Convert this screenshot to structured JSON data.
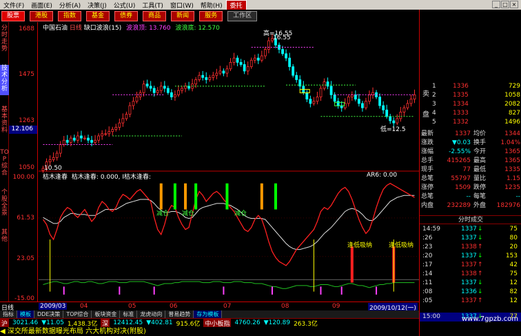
{
  "menu": {
    "items": [
      "文件(F)",
      "画面(E)",
      "分析(A)",
      "决策(J)",
      "公式(U)",
      "工具(T)",
      "窗口(W)",
      "帮助(H)"
    ],
    "highlight": "委托"
  },
  "toolbar": {
    "buttons": [
      "股票",
      "港股",
      "指数",
      "基金",
      "债券",
      "商品",
      "新闻",
      "服务"
    ],
    "extra": "工作区"
  },
  "left_tabs": [
    "分时走势",
    "技术分析",
    "基本资料",
    "TOP综合",
    "个股全景",
    "其他"
  ],
  "yaxis": {
    "upper": [
      "1688",
      "1475",
      "1263",
      "1050"
    ],
    "current": "12.106",
    "lower": [
      "100.00",
      "61.53",
      "23.05",
      "-15.00"
    ]
  },
  "price_panel": {
    "title": "中国石油",
    "period": "日线",
    "indicator": "缺口波浪(15)",
    "wave_top_label": "波浪顶:",
    "wave_top_value": "13.760",
    "wave_bottom_label": "波浪底:",
    "wave_bottom_value": "12.570",
    "high_label": "高=16.55",
    "high_value": "16.55",
    "low_label": "低=12.5",
    "left_value": "10.50"
  },
  "osc_panel": {
    "title": "枯木逢春",
    "value_label": "枯木逢春:",
    "value": "0.000,",
    "extra": "I枯木逢春:",
    "side_label": "AR6:",
    "side_value": "0.00",
    "reduce_label": "减仓",
    "buy_label": "逢低吸纳"
  },
  "chart_data": {
    "type": "candlestick",
    "x_labels": [
      "2009/03",
      "04",
      "05",
      "06",
      "07",
      "08",
      "09",
      "2009/10/12(一)"
    ],
    "ylim": [
      10.5,
      16.88
    ],
    "close": [
      10.5,
      10.8,
      10.9,
      11.0,
      11.2,
      11.6,
      11.8,
      11.7,
      11.9,
      11.8,
      12.0,
      11.9,
      11.9,
      11.8,
      11.7,
      11.8,
      12.0,
      12.1,
      12.1,
      12.2,
      12.3,
      12.4,
      12.6,
      12.8,
      13.0,
      13.4,
      13.6,
      13.8,
      14.0,
      14.4,
      14.3,
      14.2,
      14.0,
      14.1,
      14.3,
      14.2,
      14.0,
      13.8,
      13.9,
      14.1,
      14.2,
      14.3,
      14.2,
      14.4,
      14.6,
      14.8,
      14.7,
      14.6,
      14.7,
      14.8,
      14.9,
      15.0,
      14.9,
      15.1,
      15.4,
      15.6,
      15.4,
      15.3,
      15.0,
      15.2,
      15.5,
      15.6,
      15.5,
      15.7,
      16.0,
      16.4,
      16.5,
      16.2,
      16.0,
      15.8,
      15.6,
      15.2,
      14.8,
      14.6,
      14.3,
      14.0,
      13.7,
      13.5,
      13.6,
      13.8,
      14.2,
      14.5,
      14.3,
      13.9,
      13.6,
      13.4,
      13.3,
      13.5,
      13.8,
      13.9,
      13.7,
      13.5,
      13.3,
      13.6,
      13.9,
      14.0,
      13.8,
      13.4,
      13.2,
      12.9,
      12.7,
      12.6,
      12.8,
      13.1,
      13.3,
      13.5,
      13.7,
      13.9
    ],
    "osc_red": [
      60,
      55,
      45,
      40,
      50,
      62,
      68,
      72,
      70,
      65,
      62,
      66,
      70,
      64,
      58,
      62,
      72,
      78,
      75,
      70,
      68,
      72,
      80,
      85,
      83,
      80,
      84,
      88,
      90,
      86,
      82,
      78,
      62,
      50,
      45,
      55,
      68,
      74,
      72,
      62,
      55,
      50,
      52,
      66,
      80,
      88,
      84,
      78,
      82,
      86,
      88,
      85,
      80,
      76,
      72,
      68,
      62,
      56,
      50,
      48,
      52,
      60,
      64,
      60,
      50,
      38,
      28,
      22,
      18,
      16,
      14,
      18,
      24,
      30,
      34,
      38,
      42,
      46,
      50,
      58,
      68,
      72,
      70,
      74,
      80,
      86,
      90,
      92,
      88,
      80,
      70,
      60,
      52,
      46,
      50,
      60,
      72,
      82,
      90,
      94,
      96,
      94,
      92,
      90,
      88,
      86,
      84,
      82
    ],
    "osc_white": [
      62,
      60,
      58,
      56,
      56,
      58,
      62,
      64,
      66,
      66,
      65,
      65,
      65,
      64,
      64,
      64,
      66,
      68,
      70,
      70,
      70,
      70,
      72,
      74,
      76,
      77,
      78,
      79,
      80,
      80,
      80,
      79,
      76,
      72,
      69,
      67,
      67,
      68,
      68,
      67,
      65,
      62,
      61,
      62,
      66,
      70,
      72,
      73,
      74,
      75,
      76,
      76,
      76,
      75,
      74,
      72,
      70,
      67,
      64,
      62,
      61,
      61,
      61,
      61,
      60,
      56,
      52,
      48,
      44,
      40,
      36,
      33,
      31,
      30,
      30,
      31,
      32,
      33,
      35,
      38,
      42,
      46,
      49,
      52,
      56,
      60,
      64,
      68,
      70,
      71,
      70,
      68,
      65,
      61,
      59,
      59,
      62,
      66,
      70,
      74,
      78,
      80,
      82,
      83,
      84,
      84,
      84,
      84
    ],
    "osc_green": [
      -5,
      -4,
      -3,
      -2,
      -2,
      -3,
      -4,
      -4,
      -3,
      -2,
      -2,
      -3,
      -3,
      -2,
      -2,
      -3,
      -4,
      -4,
      -3,
      -2,
      -2,
      -2,
      -3,
      -3,
      -3,
      -2,
      -2,
      -2,
      -2,
      -2,
      -3,
      -4,
      -5,
      -6,
      -5,
      -4,
      -4,
      -4,
      -3,
      -3,
      -2,
      -2,
      -2,
      -2,
      -2,
      -2,
      -3,
      -3,
      -3,
      -2,
      -2,
      -2,
      -3,
      -3,
      -3,
      -2,
      -2,
      -2,
      -3,
      -3,
      -3,
      -4,
      -4,
      -4,
      -5,
      -6,
      -7,
      -7,
      -8,
      -9,
      -9,
      -8,
      -7,
      -6,
      -6,
      -6,
      -6,
      -7,
      -7,
      -6,
      -5,
      -5,
      -5,
      -6,
      -7,
      -7,
      -6,
      -5,
      -4,
      -4,
      -5,
      -6,
      -6,
      -7,
      -8,
      -7,
      -6,
      -5,
      -5,
      -4,
      -4,
      -3,
      -3,
      -3,
      -3,
      -3,
      -3,
      -3
    ]
  },
  "orderbook": {
    "sell_label": "卖",
    "buy_label": "盘",
    "rows": [
      {
        "level": "",
        "price": "",
        "volume": ""
      },
      {
        "level": "1",
        "price": "1336",
        "volume": "729"
      },
      {
        "level": "2",
        "price": "1335",
        "volume": "1058"
      },
      {
        "level": "3",
        "price": "1334",
        "volume": "2082"
      },
      {
        "level": "4",
        "price": "1333",
        "volume": "827"
      },
      {
        "level": "5",
        "price": "1332",
        "volume": "1496"
      }
    ]
  },
  "stats": [
    {
      "l1": "最新",
      "v1": "1337",
      "l2": "均价",
      "v2": "1344"
    },
    {
      "l1": "涨跌",
      "v1": "▼0.03",
      "l2": "换手",
      "v2": "1.04%"
    },
    {
      "l1": "涨幅",
      "v1": "-2.55%",
      "l2": "今开",
      "v2": "1365"
    },
    {
      "l1": "总手",
      "v1": "415265",
      "l2": "最高",
      "v2": "1365"
    },
    {
      "l1": "现手",
      "v1": "77",
      "l2": "最低",
      "v2": "1335"
    },
    {
      "l1": "总笔",
      "v1": "55797",
      "l2": "量比",
      "v2": "1.15"
    },
    {
      "l1": "涨停",
      "v1": "1509",
      "l2": "跌停",
      "v2": "1235"
    },
    {
      "l1": "总笔",
      "v1": "--",
      "l2": "每笔",
      "v2": "--"
    },
    {
      "l1": "内盘",
      "v1": "232289",
      "l2": "外盘",
      "v2": "182976"
    }
  ],
  "trades": {
    "header": "分时成交",
    "rows": [
      {
        "time": "14:59",
        "price": "1337",
        "arrow": "↓",
        "volume": "75"
      },
      {
        "time": ":26",
        "price": "1337",
        "arrow": "↓",
        "volume": "80"
      },
      {
        "time": ":23",
        "price": "1338",
        "arrow": "↑",
        "volume": "20"
      },
      {
        "time": ":20",
        "price": "1337",
        "arrow": "↓",
        "volume": "153"
      },
      {
        "time": ":17",
        "price": "1337",
        "arrow": "↑",
        "volume": "42"
      },
      {
        "time": ":14",
        "price": "1338",
        "arrow": "↑",
        "volume": "75"
      },
      {
        "time": ":11",
        "price": "1337",
        "arrow": "↓",
        "volume": "12"
      },
      {
        "time": ":08",
        "price": "1336",
        "arrow": "↓",
        "volume": "82"
      },
      {
        "time": ":05",
        "price": "1337",
        "arrow": "↑",
        "volume": "12"
      },
      {
        "time": "15:00",
        "price": "1337",
        "arrow": "↓",
        "volume": "77"
      }
    ]
  },
  "dates": [
    "2009/03",
    "04",
    "05",
    "06",
    "07",
    "08",
    "09",
    "2009/10/12(一)"
  ],
  "sheets": [
    "指标",
    "模板",
    "DDE决策",
    "TOP综合",
    "板块资金",
    "标准",
    "龙虎动向",
    "普易趋势",
    "存为模板"
  ],
  "status": {
    "sh_label": "沪",
    "sh_value": "3021.46",
    "sh_change": "▼11.05",
    "sh_amount": "1,438.3亿",
    "sz_label": "深",
    "sz_value": "12412.45",
    "sz_change": "▼402.81",
    "sz_amount": "915.6亿",
    "sme_label": "中小板指",
    "sme_value": "4760.26",
    "sme_change": "▼120.89",
    "sme_amount": "263.3亿"
  },
  "ticker": "深交所最新数据曝光布局 六大机构对决(附股)",
  "watermark": "www.7gpzb.com",
  "colors": {
    "up": "#ff3030",
    "down": "#00ffff",
    "accent": "#c00000"
  }
}
